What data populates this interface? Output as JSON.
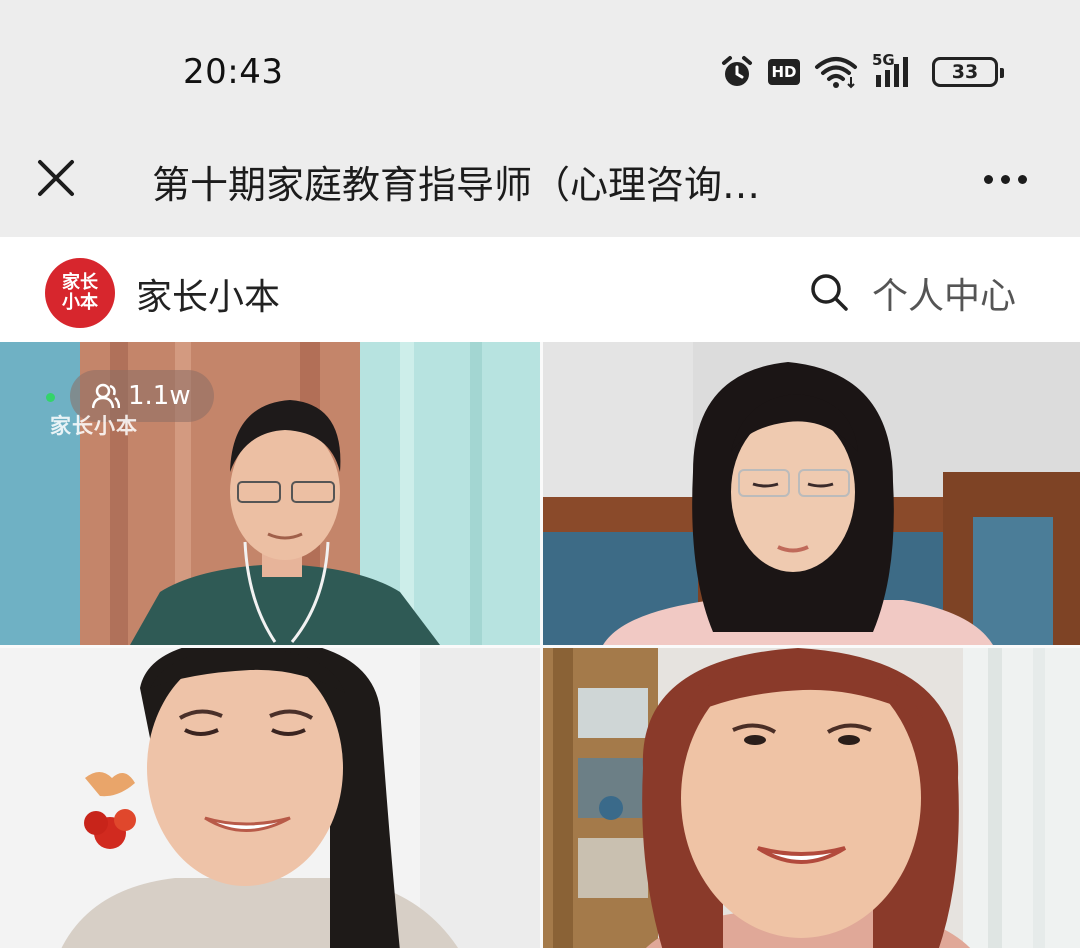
{
  "status_bar": {
    "time": "20:43",
    "hd_label": "HD",
    "network_label": "5G",
    "battery": "33"
  },
  "title_bar": {
    "title": "第十期家庭教育指导师（心理咨询…",
    "close_icon": "close-icon",
    "more_icon": "more-icon"
  },
  "app_header": {
    "logo_line1": "家长",
    "logo_line2": "小本",
    "brand_name": "家长小本",
    "search_icon": "search-icon",
    "personal_center": "个人中心"
  },
  "video_grid": {
    "viewer_count": "1.1w",
    "watermark": "家长小本",
    "tiles": [
      "participant-1",
      "participant-2",
      "participant-3",
      "participant-4"
    ]
  },
  "colors": {
    "brand_red": "#d7262d",
    "chrome_gray": "#ededed",
    "live_green": "#33d46a"
  }
}
